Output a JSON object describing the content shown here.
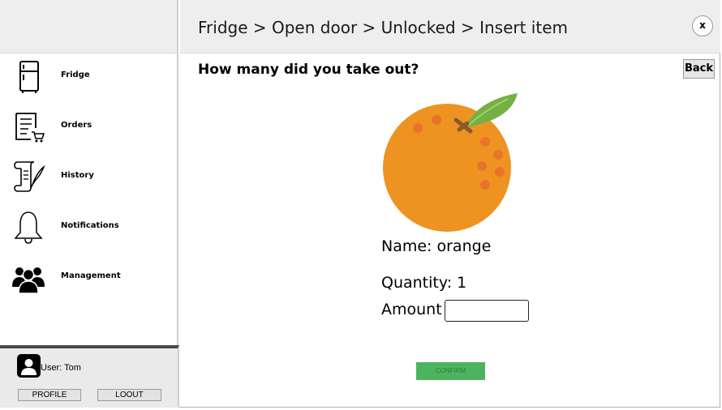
{
  "header": {
    "breadcrumb": "Fridge > Open door > Unlocked > Insert item",
    "close_label": "x"
  },
  "sidebar": {
    "items": [
      {
        "label": "Fridge",
        "icon": "fridge-icon"
      },
      {
        "label": "Orders",
        "icon": "orders-icon"
      },
      {
        "label": "History",
        "icon": "history-scroll-icon"
      },
      {
        "label": "Notifications",
        "icon": "bell-icon"
      },
      {
        "label": "Management",
        "icon": "users-group-icon"
      }
    ]
  },
  "user": {
    "label": "User: Tom",
    "profile_button": "PROFILE",
    "logout_button": "LOOUT"
  },
  "main": {
    "question": "How many did you take out?",
    "back_button": "Back",
    "item_image": "orange-fruit-image",
    "name_line": "Name: orange",
    "quantity_line": "Quantity: 1",
    "amount_label": "Amount",
    "amount_value": "",
    "confirm_button": "CONFIRM"
  },
  "colors": {
    "header_bg": "#eeeeee",
    "confirm_green": "#4cb45e",
    "orange": "#ee9322",
    "leaf": "#74b043"
  }
}
